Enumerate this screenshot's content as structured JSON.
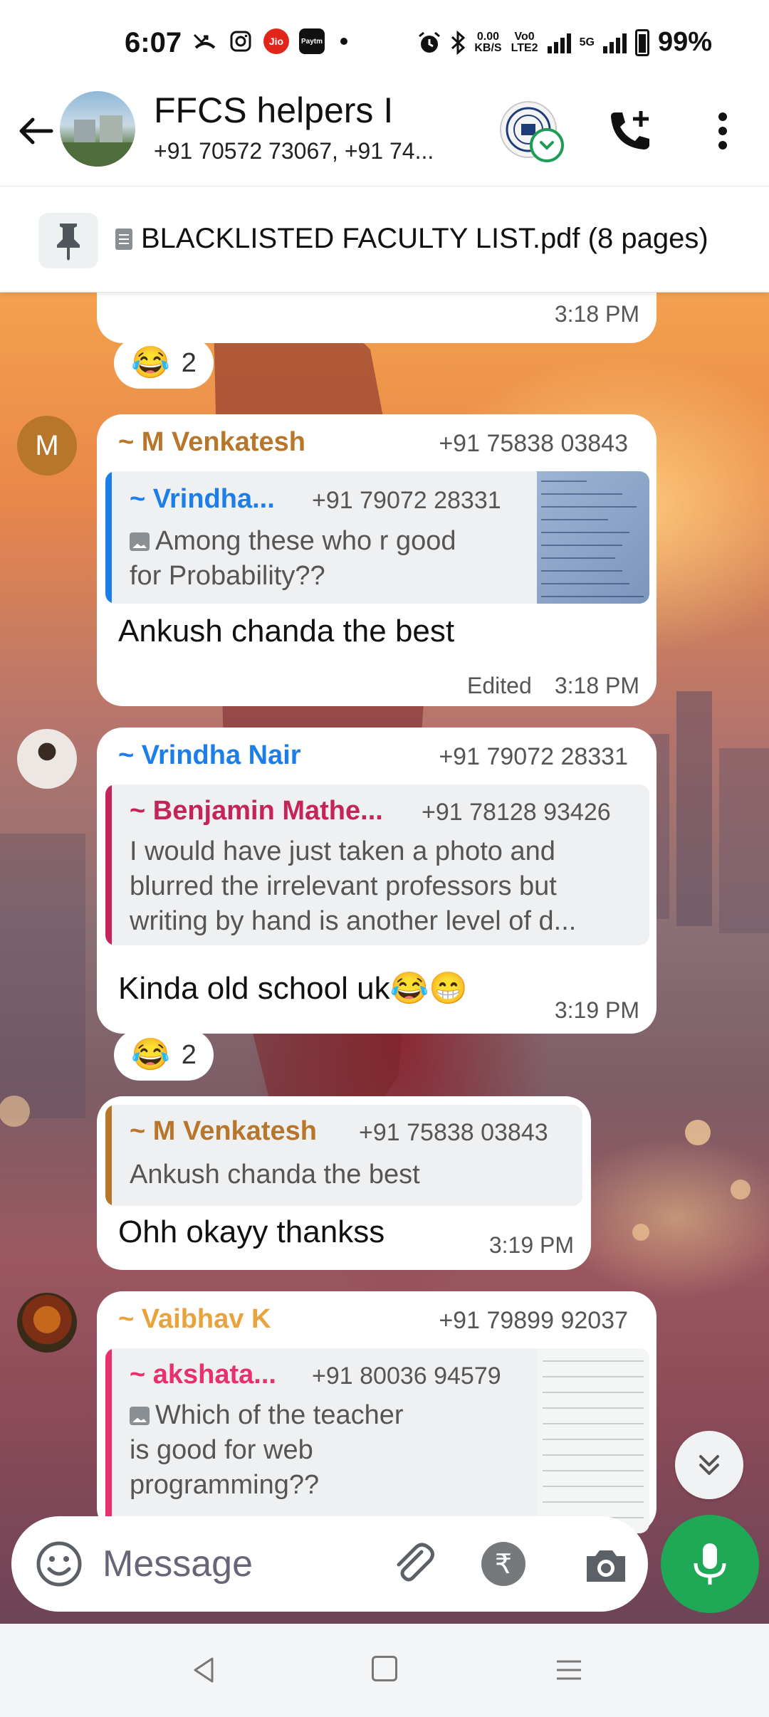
{
  "status_bar": {
    "time": "6:07",
    "jio": "Jio",
    "paytm": "Paytm",
    "net_speed_value": "0.00",
    "net_speed_unit": "KB/S",
    "volte": "Vo0 LTE2",
    "network": "5G",
    "battery": "99%"
  },
  "header": {
    "title": "FFCS helpers I",
    "members": "+91 70572 73067, +91 74..."
  },
  "pinned": {
    "text": "BLACKLISTED FACULTY LIST.pdf (8 pages)"
  },
  "messages": [
    {
      "time": "3:18 PM",
      "reaction": {
        "emoji": "😂",
        "count": "2"
      }
    },
    {
      "avatar_letter": "M",
      "sender": "~ M Venkatesh",
      "phone": "+91 75838 03843",
      "reply": {
        "name": "~ Vrindha...",
        "phone": "+91 79072 28331",
        "text": "Among these who r good for Probability??"
      },
      "text": "Ankush chanda the best",
      "edited": "Edited",
      "time": "3:18 PM"
    },
    {
      "sender": "~ Vrindha Nair",
      "phone": "+91 79072 28331",
      "reply": {
        "name": "~ Benjamin Mathe...",
        "phone": "+91 78128 93426",
        "text": "I would have just taken a photo and blurred the irrelevant professors but writing by hand is another level of d..."
      },
      "text": "Kinda old school uk😂😁",
      "time": "3:19 PM",
      "reaction": {
        "emoji": "😂",
        "count": "2"
      }
    },
    {
      "reply": {
        "name": "~ M Venkatesh",
        "phone": "+91 75838 03843",
        "text": "Ankush chanda the best"
      },
      "text": "Ohh okayy thankss",
      "time": "3:19 PM"
    },
    {
      "sender": "~ Vaibhav K",
      "phone": "+91 79899 92037",
      "reply": {
        "name": "~ akshata...",
        "phone": "+91 80036 94579",
        "text": "Which of the teacher is good for web programming??"
      }
    }
  ],
  "input": {
    "placeholder": "Message",
    "rupee": "₹"
  },
  "colors": {
    "accent": "#1fa855",
    "venkatesh": "#b8762a",
    "vrindha": "#1c7ee8",
    "benjamin": "#c4245a",
    "vaibhav": "#e8a33c",
    "akshata": "#e8306c"
  }
}
